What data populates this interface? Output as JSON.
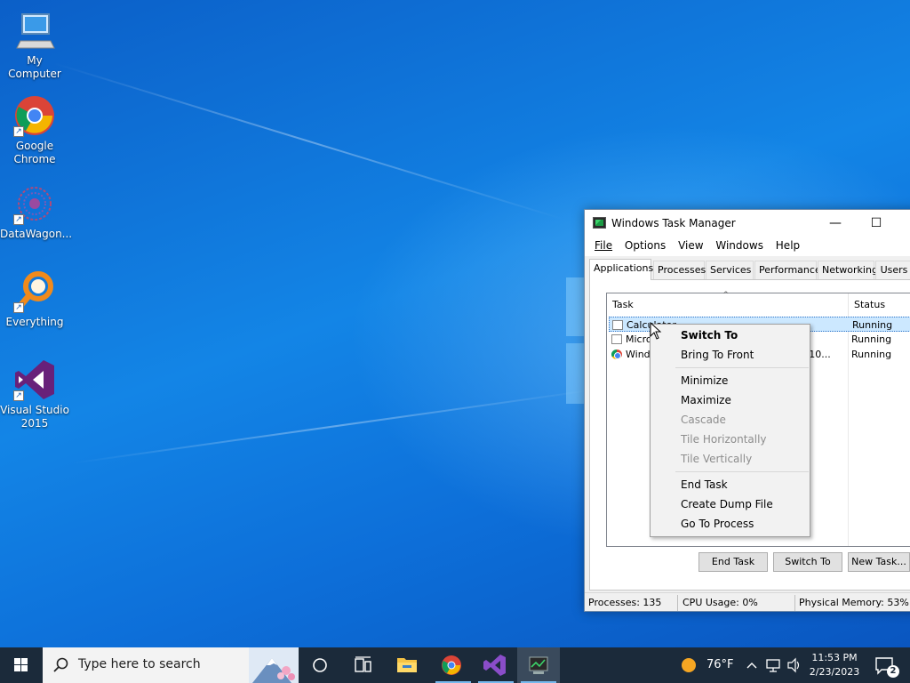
{
  "desktop": {
    "icons": [
      {
        "label": "My Computer",
        "icon": "computer-icon"
      },
      {
        "label": "Google Chrome",
        "icon": "chrome-icon"
      },
      {
        "label": "DataWagon...",
        "icon": "datawagon-icon"
      },
      {
        "label": "Everything",
        "icon": "everything-search-icon"
      },
      {
        "label": "Visual Studio 2015",
        "icon": "visual-studio-icon"
      }
    ]
  },
  "task_manager": {
    "title": "Windows Task Manager",
    "menu": [
      "File",
      "Options",
      "View",
      "Windows",
      "Help"
    ],
    "tabs": [
      "Applications",
      "Processes",
      "Services",
      "Performance",
      "Networking",
      "Users"
    ],
    "active_tab": "Applications",
    "columns": {
      "task": "Task",
      "status": "Status"
    },
    "rows": [
      {
        "task": "Calculator",
        "status": "Running",
        "selected": true
      },
      {
        "task": "Micro",
        "status": "Running"
      },
      {
        "task": "Windo",
        "task_tail": "ws 10...",
        "status": "Running"
      }
    ],
    "buttons": {
      "end_task": "End Task",
      "switch_to": "Switch To",
      "new_task": "New Task..."
    },
    "status_bar": {
      "processes": "Processes: 135",
      "cpu": "CPU Usage: 0%",
      "memory": "Physical Memory: 53%"
    },
    "titlebar_buttons": {
      "minimize": "—",
      "maximize": "☐"
    }
  },
  "context_menu": {
    "items": [
      {
        "label": "Switch To",
        "style": "bold"
      },
      {
        "label": "Bring To Front"
      },
      {
        "label": "Minimize"
      },
      {
        "label": "Maximize"
      },
      {
        "label": "Cascade",
        "disabled": true
      },
      {
        "label": "Tile Horizontally",
        "disabled": true
      },
      {
        "label": "Tile Vertically",
        "disabled": true
      },
      {
        "label": "End Task"
      },
      {
        "label": "Create Dump File"
      },
      {
        "label": "Go To Process"
      }
    ]
  },
  "taskbar": {
    "search_placeholder": "Type here to search",
    "weather": "76°F",
    "time": "11:53 PM",
    "date": "2/23/2023",
    "notification_count": "2"
  },
  "colors": {
    "desktop_blue": "#0a6fd8",
    "taskbar": "#1b2a3a",
    "selection": "#cce8ff"
  }
}
